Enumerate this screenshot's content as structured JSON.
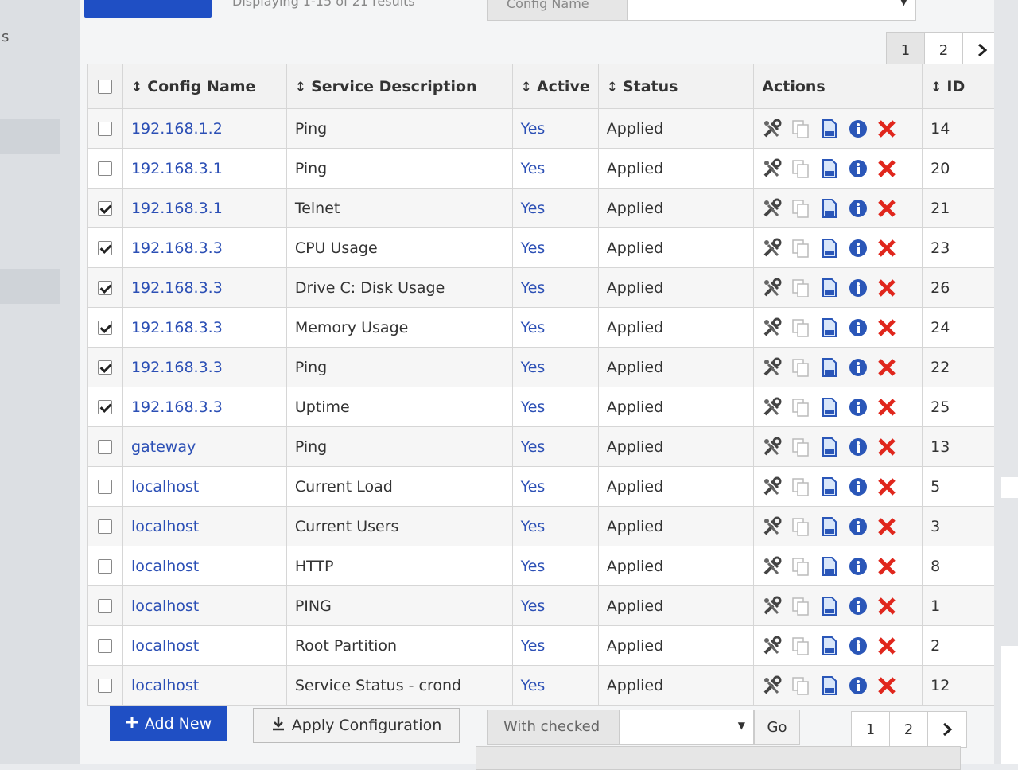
{
  "top": {
    "add_new_label": "",
    "results_info": "Displaying 1-15 of 21 results",
    "filter_label": "Config Name"
  },
  "pagination": {
    "pages": [
      "1",
      "2"
    ],
    "current": "1"
  },
  "table": {
    "headers": {
      "config_name": "Config Name",
      "service_description": "Service Description",
      "active": "Active",
      "status": "Status",
      "actions": "Actions",
      "id": "ID"
    },
    "rows": [
      {
        "checked": false,
        "config": "192.168.1.2",
        "service": "Ping",
        "active": "Yes",
        "status": "Applied",
        "id": "14"
      },
      {
        "checked": false,
        "config": "192.168.3.1",
        "service": "Ping",
        "active": "Yes",
        "status": "Applied",
        "id": "20"
      },
      {
        "checked": true,
        "config": "192.168.3.1",
        "service": "Telnet",
        "active": "Yes",
        "status": "Applied",
        "id": "21"
      },
      {
        "checked": true,
        "config": "192.168.3.3",
        "service": "CPU Usage",
        "active": "Yes",
        "status": "Applied",
        "id": "23"
      },
      {
        "checked": true,
        "config": "192.168.3.3",
        "service": "Drive C: Disk Usage",
        "active": "Yes",
        "status": "Applied",
        "id": "26"
      },
      {
        "checked": true,
        "config": "192.168.3.3",
        "service": "Memory Usage",
        "active": "Yes",
        "status": "Applied",
        "id": "24"
      },
      {
        "checked": true,
        "config": "192.168.3.3",
        "service": "Ping",
        "active": "Yes",
        "status": "Applied",
        "id": "22"
      },
      {
        "checked": true,
        "config": "192.168.3.3",
        "service": "Uptime",
        "active": "Yes",
        "status": "Applied",
        "id": "25"
      },
      {
        "checked": false,
        "config": "gateway",
        "service": "Ping",
        "active": "Yes",
        "status": "Applied",
        "id": "13"
      },
      {
        "checked": false,
        "config": "localhost",
        "service": "Current Load",
        "active": "Yes",
        "status": "Applied",
        "id": "5"
      },
      {
        "checked": false,
        "config": "localhost",
        "service": "Current Users",
        "active": "Yes",
        "status": "Applied",
        "id": "3"
      },
      {
        "checked": false,
        "config": "localhost",
        "service": "HTTP",
        "active": "Yes",
        "status": "Applied",
        "id": "8"
      },
      {
        "checked": false,
        "config": "localhost",
        "service": "PING",
        "active": "Yes",
        "status": "Applied",
        "id": "1"
      },
      {
        "checked": false,
        "config": "localhost",
        "service": "Root Partition",
        "active": "Yes",
        "status": "Applied",
        "id": "2"
      },
      {
        "checked": false,
        "config": "localhost",
        "service": "Service Status - crond",
        "active": "Yes",
        "status": "Applied",
        "id": "12"
      }
    ]
  },
  "bottom": {
    "add_new_label": "Add New",
    "apply_label": "Apply Configuration",
    "with_checked_label": "With checked",
    "go_label": "Go"
  },
  "icons": {
    "edit": "wrench-scissors-icon",
    "copy": "copy-icon",
    "view_config": "document-icon",
    "info": "info-icon",
    "delete": "delete-x-icon",
    "sort": "sort-arrows-icon",
    "next": "chevron-right-icon",
    "plus": "plus-icon",
    "download": "download-icon",
    "caret": "caret-down-icon"
  },
  "colors": {
    "primary": "#1f4fc4",
    "link": "#2b4fb5",
    "delete": "#e0261c",
    "info": "#2a56b8"
  }
}
